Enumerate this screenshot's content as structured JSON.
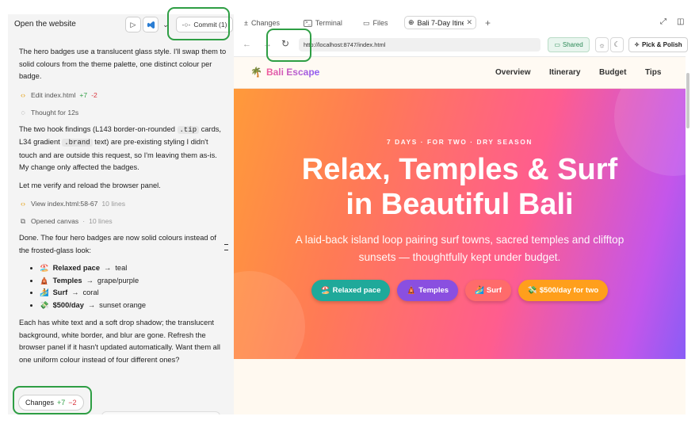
{
  "left_panel": {
    "title": "Open the website",
    "commit_label": "Commit (1)",
    "clipped_line": "Thought for 12s",
    "paragraph1": "The hero badges use a translucent glass style. I'll swap them to solid colours from the theme palette, one distinct colour per badge.",
    "edit_line": {
      "label": "Edit index.html",
      "added": "+7",
      "removed": "-2"
    },
    "thought_line": "Thought for 12s",
    "paragraph2_parts": {
      "a": "The two hook findings (L143 border-on-rounded ",
      "code1": ".tip",
      "b": " cards, L34 gradient ",
      "code2": ".brand",
      "c": " text) are pre-existing styling I didn't touch and are outside this request, so I'm leaving them as-is. My change only affected the badges."
    },
    "paragraph3": "Let me verify and reload the browser panel.",
    "view_line": {
      "label": "View index.html:58-67",
      "meta": "10 lines"
    },
    "canvas_line": {
      "label": "Opened canvas",
      "meta": "10 lines"
    },
    "paragraph4": "Done. The four hero badges are now solid colours instead of the frosted-glass look:",
    "bullets": [
      {
        "emoji": "🏖️",
        "name": "Relaxed pace",
        "colour": "teal"
      },
      {
        "emoji": "🛕",
        "name": "Temples",
        "colour": "grape/purple"
      },
      {
        "emoji": "🏄",
        "name": "Surf",
        "colour": "coral"
      },
      {
        "emoji": "💸",
        "name": "$500/day",
        "colour": "sunset orange"
      }
    ],
    "paragraph5": "Each has white text and a soft drop shadow; the translucent background, white border, and blur are gone. Refresh the browser panel if it hasn't updated automatically. Want them all one uniform colour instead of four different ones?",
    "changes_chip": {
      "label": "Changes",
      "added": "+7",
      "removed": "−2"
    }
  },
  "tabs": {
    "changes": "Changes",
    "terminal": "Terminal",
    "files": "Files",
    "active": "Bali 7-Day Itinerary"
  },
  "address_bar": {
    "url": "http://localhost:8747/index.html",
    "shared_label": "Shared",
    "pick_label": "Pick & Polish"
  },
  "site": {
    "brand": "Bali Escape",
    "nav": [
      "Overview",
      "Itinerary",
      "Budget",
      "Tips"
    ],
    "kicker": "7 DAYS · FOR TWO · DRY SEASON",
    "headline_line1": "Relax, Temples & Surf",
    "headline_line2": "in Beautiful Bali",
    "subtitle": "A laid-back island loop pairing surf towns, sacred temples and clifftop sunsets — thoughtfully kept under budget.",
    "badges": [
      {
        "emoji": "🏖️",
        "label": "Relaxed pace",
        "color": "#1fa99a"
      },
      {
        "emoji": "🛕",
        "label": "Temples",
        "color": "#8a4fe0"
      },
      {
        "emoji": "🏄",
        "label": "Surf",
        "color": "#ff6b6b"
      },
      {
        "emoji": "💸",
        "label": "$500/day for two",
        "color": "#ff9f1c"
      }
    ]
  },
  "colors": {
    "annotation": "#2e9e44",
    "hero_gradient": [
      "#ff9a3a",
      "#ff5d8e",
      "#8a5cf6"
    ]
  }
}
